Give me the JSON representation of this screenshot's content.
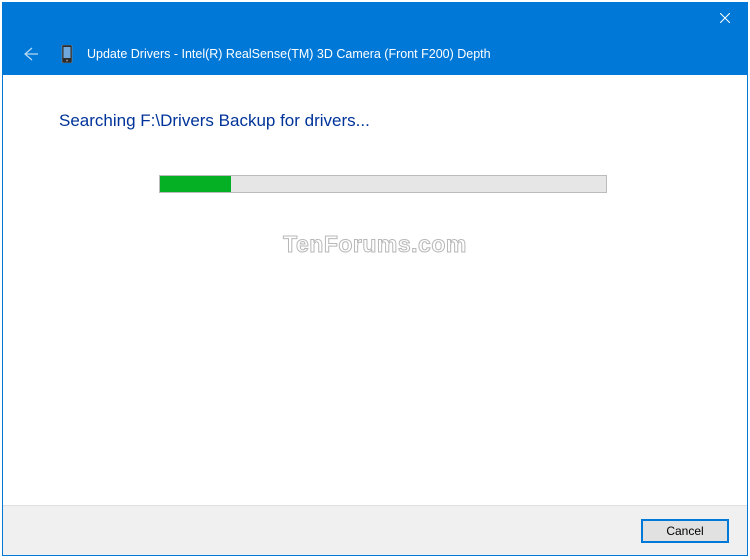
{
  "titlebar": {
    "close_label": "Close"
  },
  "header": {
    "back_label": "Back",
    "title": "Update Drivers - Intel(R) RealSense(TM) 3D Camera (Front F200) Depth"
  },
  "content": {
    "status_text": "Searching F:\\Drivers Backup for drivers...",
    "progress_percent": 16
  },
  "footer": {
    "cancel_label": "Cancel"
  },
  "watermark": "TenForums.com"
}
